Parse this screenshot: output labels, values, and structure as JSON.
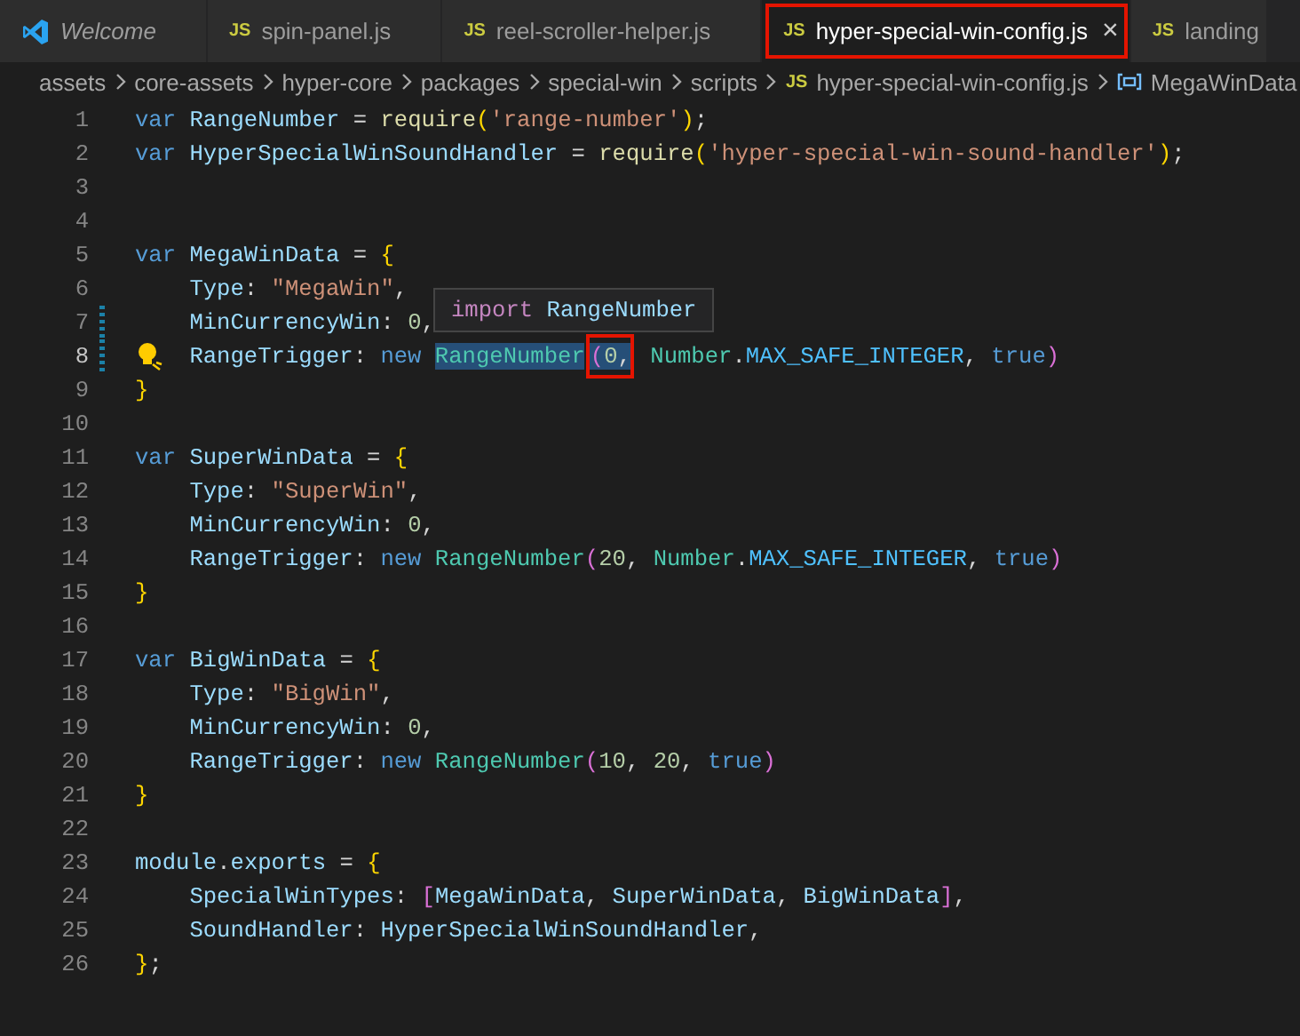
{
  "tabs": [
    {
      "label": "Welcome",
      "kind": "welcome",
      "selected": false,
      "outlined": false,
      "closable": false
    },
    {
      "label": "spin-panel.js",
      "kind": "js",
      "icon_text": "JS",
      "selected": false,
      "outlined": false,
      "closable": false
    },
    {
      "label": "reel-scroller-helper.js",
      "kind": "js",
      "icon_text": "JS",
      "selected": false,
      "outlined": false,
      "closable": false
    },
    {
      "label": "hyper-special-win-config.js",
      "kind": "js",
      "icon_text": "JS",
      "selected": true,
      "outlined": true,
      "closable": true,
      "close": "×"
    },
    {
      "label": "landing",
      "kind": "js",
      "icon_text": "JS",
      "selected": false,
      "outlined": false,
      "closable": false
    }
  ],
  "breadcrumb": [
    {
      "label": "assets",
      "kind": "folder"
    },
    {
      "label": "core-assets",
      "kind": "folder"
    },
    {
      "label": "hyper-core",
      "kind": "folder"
    },
    {
      "label": "packages",
      "kind": "folder"
    },
    {
      "label": "special-win",
      "kind": "folder"
    },
    {
      "label": "scripts",
      "kind": "folder"
    },
    {
      "label": "hyper-special-win-config.js",
      "kind": "file",
      "icon_text": "JS"
    },
    {
      "label": "MegaWinData",
      "kind": "symbol"
    }
  ],
  "editor": {
    "lines": [
      {
        "number": "1",
        "indent": false,
        "current": false,
        "modified": false,
        "lightbulb": false,
        "tokens": [
          {
            "kind": "keyword",
            "text": "var "
          },
          {
            "kind": "variable",
            "text": "RangeNumber"
          },
          {
            "kind": "plain",
            "text": " = "
          },
          {
            "kind": "function",
            "text": "require"
          },
          {
            "kind": "bracket1",
            "text": "("
          },
          {
            "kind": "string",
            "text": "'range-number'"
          },
          {
            "kind": "bracket1",
            "text": ")"
          },
          {
            "kind": "plain",
            "text": ";"
          }
        ]
      },
      {
        "number": "2",
        "indent": false,
        "current": false,
        "modified": false,
        "lightbulb": false,
        "tokens": [
          {
            "kind": "keyword",
            "text": "var "
          },
          {
            "kind": "variable",
            "text": "HyperSpecialWinSoundHandler"
          },
          {
            "kind": "plain",
            "text": " = "
          },
          {
            "kind": "function",
            "text": "require"
          },
          {
            "kind": "bracket1",
            "text": "("
          },
          {
            "kind": "string",
            "text": "'hyper-special-win-sound-handler'"
          },
          {
            "kind": "bracket1",
            "text": ")"
          },
          {
            "kind": "plain",
            "text": ";"
          }
        ]
      },
      {
        "number": "3",
        "current": false,
        "modified": false,
        "lightbulb": false
      },
      {
        "number": "4",
        "current": false,
        "modified": false,
        "lightbulb": false
      },
      {
        "number": "5",
        "indent": false,
        "current": false,
        "modified": false,
        "lightbulb": false,
        "tokens": [
          {
            "kind": "keyword",
            "text": "var "
          },
          {
            "kind": "variable",
            "text": "MegaWinData"
          },
          {
            "kind": "plain",
            "text": " = "
          },
          {
            "kind": "bracket1",
            "text": "{"
          }
        ]
      },
      {
        "number": "6",
        "indent": true,
        "current": false,
        "modified": false,
        "lightbulb": false,
        "tokens": [
          {
            "kind": "variable",
            "text": "Type"
          },
          {
            "kind": "plain",
            "text": ": "
          },
          {
            "kind": "string",
            "text": "\"MegaWin\""
          },
          {
            "kind": "plain",
            "text": ","
          }
        ]
      },
      {
        "number": "7",
        "indent": true,
        "current": false,
        "modified": true,
        "lightbulb": false,
        "tokens": [
          {
            "kind": "variable",
            "text": "MinCurrencyWin"
          },
          {
            "kind": "plain",
            "text": ": "
          },
          {
            "kind": "number",
            "text": "0"
          },
          {
            "kind": "plain",
            "text": ","
          }
        ]
      },
      {
        "number": "8",
        "indent": true,
        "current": true,
        "modified": true,
        "lightbulb": true,
        "tokens": [
          {
            "kind": "variable",
            "text": "RangeTrigger"
          },
          {
            "kind": "plain",
            "text": ": "
          },
          {
            "kind": "keyword",
            "text": "new "
          },
          {
            "kind": "class",
            "text": "RangeNumber",
            "highlighted": true
          },
          {
            "kind": "group",
            "outlined": true,
            "tokens": [
              {
                "kind": "bracket2",
                "text": "(",
                "highlighted": true
              },
              {
                "kind": "number",
                "text": "0",
                "highlighted": true
              },
              {
                "kind": "plain",
                "text": ",",
                "highlighted": true
              }
            ]
          },
          {
            "kind": "class",
            "text": " Number"
          },
          {
            "kind": "plain",
            "text": "."
          },
          {
            "kind": "constant",
            "text": "MAX_SAFE_INTEGER"
          },
          {
            "kind": "plain",
            "text": ", "
          },
          {
            "kind": "keyword",
            "text": "true"
          },
          {
            "kind": "bracket2",
            "text": ")"
          }
        ]
      },
      {
        "number": "9",
        "indent": false,
        "current": false,
        "modified": false,
        "lightbulb": false,
        "tokens": [
          {
            "kind": "bracket1",
            "text": "}"
          }
        ]
      },
      {
        "number": "10",
        "current": false,
        "modified": false,
        "lightbulb": false
      },
      {
        "number": "11",
        "indent": false,
        "current": false,
        "modified": false,
        "lightbulb": false,
        "tokens": [
          {
            "kind": "keyword",
            "text": "var "
          },
          {
            "kind": "variable",
            "text": "SuperWinData"
          },
          {
            "kind": "plain",
            "text": " = "
          },
          {
            "kind": "bracket1",
            "text": "{"
          }
        ]
      },
      {
        "number": "12",
        "indent": true,
        "current": false,
        "modified": false,
        "lightbulb": false,
        "tokens": [
          {
            "kind": "variable",
            "text": "Type"
          },
          {
            "kind": "plain",
            "text": ": "
          },
          {
            "kind": "string",
            "text": "\"SuperWin\""
          },
          {
            "kind": "plain",
            "text": ","
          }
        ]
      },
      {
        "number": "13",
        "indent": true,
        "current": false,
        "modified": false,
        "lightbulb": false,
        "tokens": [
          {
            "kind": "variable",
            "text": "MinCurrencyWin"
          },
          {
            "kind": "plain",
            "text": ": "
          },
          {
            "kind": "number",
            "text": "0"
          },
          {
            "kind": "plain",
            "text": ","
          }
        ]
      },
      {
        "number": "14",
        "indent": true,
        "current": false,
        "modified": false,
        "lightbulb": false,
        "tokens": [
          {
            "kind": "variable",
            "text": "RangeTrigger"
          },
          {
            "kind": "plain",
            "text": ": "
          },
          {
            "kind": "keyword",
            "text": "new "
          },
          {
            "kind": "class",
            "text": "RangeNumber"
          },
          {
            "kind": "bracket2",
            "text": "("
          },
          {
            "kind": "number",
            "text": "20"
          },
          {
            "kind": "plain",
            "text": ", "
          },
          {
            "kind": "class",
            "text": "Number"
          },
          {
            "kind": "plain",
            "text": "."
          },
          {
            "kind": "constant",
            "text": "MAX_SAFE_INTEGER"
          },
          {
            "kind": "plain",
            "text": ", "
          },
          {
            "kind": "keyword",
            "text": "true"
          },
          {
            "kind": "bracket2",
            "text": ")"
          }
        ]
      },
      {
        "number": "15",
        "indent": false,
        "current": false,
        "modified": false,
        "lightbulb": false,
        "tokens": [
          {
            "kind": "bracket1",
            "text": "}"
          }
        ]
      },
      {
        "number": "16",
        "current": false,
        "modified": false,
        "lightbulb": false
      },
      {
        "number": "17",
        "indent": false,
        "current": false,
        "modified": false,
        "lightbulb": false,
        "tokens": [
          {
            "kind": "keyword",
            "text": "var "
          },
          {
            "kind": "variable",
            "text": "BigWinData"
          },
          {
            "kind": "plain",
            "text": " = "
          },
          {
            "kind": "bracket1",
            "text": "{"
          }
        ]
      },
      {
        "number": "18",
        "indent": true,
        "current": false,
        "modified": false,
        "lightbulb": false,
        "tokens": [
          {
            "kind": "variable",
            "text": "Type"
          },
          {
            "kind": "plain",
            "text": ": "
          },
          {
            "kind": "string",
            "text": "\"BigWin\""
          },
          {
            "kind": "plain",
            "text": ","
          }
        ]
      },
      {
        "number": "19",
        "indent": true,
        "current": false,
        "modified": false,
        "lightbulb": false,
        "tokens": [
          {
            "kind": "variable",
            "text": "MinCurrencyWin"
          },
          {
            "kind": "plain",
            "text": ": "
          },
          {
            "kind": "number",
            "text": "0"
          },
          {
            "kind": "plain",
            "text": ","
          }
        ]
      },
      {
        "number": "20",
        "indent": true,
        "current": false,
        "modified": false,
        "lightbulb": false,
        "tokens": [
          {
            "kind": "variable",
            "text": "RangeTrigger"
          },
          {
            "kind": "plain",
            "text": ": "
          },
          {
            "kind": "keyword",
            "text": "new "
          },
          {
            "kind": "class",
            "text": "RangeNumber"
          },
          {
            "kind": "bracket2",
            "text": "("
          },
          {
            "kind": "number",
            "text": "10"
          },
          {
            "kind": "plain",
            "text": ", "
          },
          {
            "kind": "number",
            "text": "20"
          },
          {
            "kind": "plain",
            "text": ", "
          },
          {
            "kind": "keyword",
            "text": "true"
          },
          {
            "kind": "bracket2",
            "text": ")"
          }
        ]
      },
      {
        "number": "21",
        "indent": false,
        "current": false,
        "modified": false,
        "lightbulb": false,
        "tokens": [
          {
            "kind": "bracket1",
            "text": "}"
          }
        ]
      },
      {
        "number": "22",
        "current": false,
        "modified": false,
        "lightbulb": false
      },
      {
        "number": "23",
        "indent": false,
        "current": false,
        "modified": false,
        "lightbulb": false,
        "tokens": [
          {
            "kind": "variable",
            "text": "module"
          },
          {
            "kind": "plain",
            "text": "."
          },
          {
            "kind": "variable",
            "text": "exports"
          },
          {
            "kind": "plain",
            "text": " = "
          },
          {
            "kind": "bracket1",
            "text": "{"
          }
        ]
      },
      {
        "number": "24",
        "indent": true,
        "current": false,
        "modified": false,
        "lightbulb": false,
        "tokens": [
          {
            "kind": "variable",
            "text": "SpecialWinTypes"
          },
          {
            "kind": "plain",
            "text": ": "
          },
          {
            "kind": "bracket2",
            "text": "["
          },
          {
            "kind": "variable",
            "text": "MegaWinData"
          },
          {
            "kind": "plain",
            "text": ", "
          },
          {
            "kind": "variable",
            "text": "SuperWinData"
          },
          {
            "kind": "plain",
            "text": ", "
          },
          {
            "kind": "variable",
            "text": "BigWinData"
          },
          {
            "kind": "bracket2",
            "text": "]"
          },
          {
            "kind": "plain",
            "text": ","
          }
        ]
      },
      {
        "number": "25",
        "indent": true,
        "current": false,
        "modified": false,
        "lightbulb": false,
        "tokens": [
          {
            "kind": "variable",
            "text": "SoundHandler"
          },
          {
            "kind": "plain",
            "text": ": "
          },
          {
            "kind": "variable",
            "text": "HyperSpecialWinSoundHandler"
          },
          {
            "kind": "plain",
            "text": ","
          }
        ]
      },
      {
        "number": "26",
        "indent": false,
        "current": false,
        "modified": false,
        "lightbulb": false,
        "tokens": [
          {
            "kind": "bracket1",
            "text": "}"
          },
          {
            "kind": "plain",
            "text": ";"
          }
        ]
      }
    ],
    "hover": {
      "keyword": "import",
      "name": "RangeNumber"
    }
  }
}
